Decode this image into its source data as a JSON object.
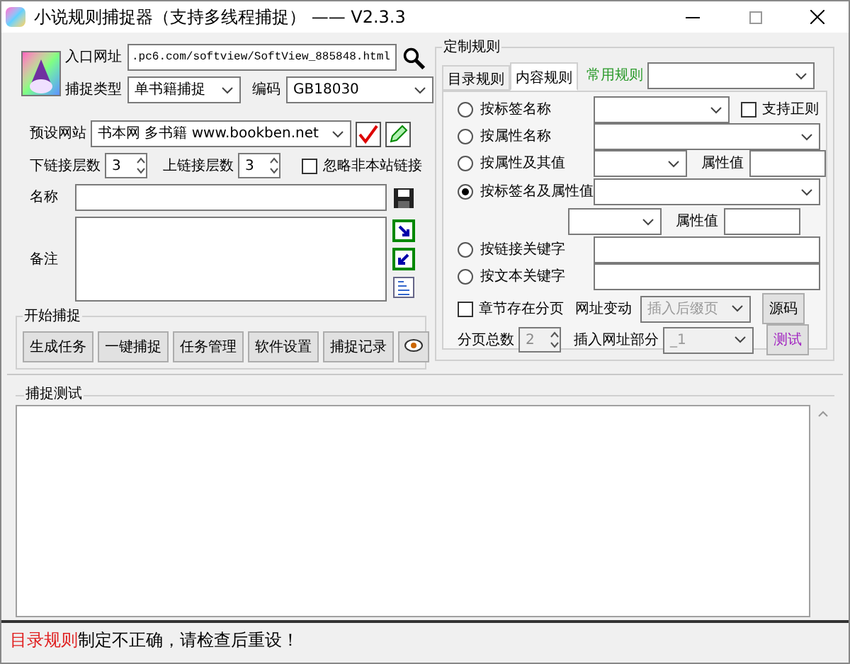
{
  "window": {
    "title": "小说规则捕捉器（支持多线程捕捉） —— V2.3.3"
  },
  "left": {
    "url": {
      "label": "入口网址",
      "value": ".pc6.com/softview/SoftView_885848.html"
    },
    "capture_type": {
      "label": "捕捉类型",
      "value": "单书籍捕捉"
    },
    "encoding": {
      "label": "编码",
      "value": "GB18030"
    },
    "preset": {
      "label": "预设网站",
      "value": "书本网 多书籍 www.bookben.net"
    },
    "down_levels": {
      "label": "下链接层数",
      "value": "3"
    },
    "up_levels": {
      "label": "上链接层数",
      "value": "3"
    },
    "ignore_external": {
      "label": "忽略非本站链接",
      "checked": false
    },
    "name": {
      "label": "名称"
    },
    "notes": {
      "label": "备注"
    },
    "start": {
      "title": "开始捕捉",
      "buttons": [
        "生成任务",
        "一键捕捉",
        "任务管理",
        "软件设置",
        "捕捉记录"
      ]
    }
  },
  "rules": {
    "title": "定制规则",
    "tabs": [
      {
        "label": "目录规则",
        "selected": false
      },
      {
        "label": "内容规则",
        "selected": true
      }
    ],
    "common_label": "常用规则",
    "options": [
      {
        "kind": "select_check",
        "label": "按标签名称",
        "selected": false,
        "check_label": "支持正则",
        "checked": false
      },
      {
        "kind": "select",
        "label": "按属性名称",
        "selected": false
      },
      {
        "kind": "select_attr",
        "label": "按属性及其值",
        "selected": false,
        "attr_label": "属性值"
      },
      {
        "kind": "select_then_attr",
        "label": "按标签名及属性值",
        "selected": true,
        "attr_label": "属性值"
      },
      {
        "kind": "input",
        "label": "按链接关键字",
        "selected": false
      },
      {
        "kind": "input",
        "label": "按文本关键字",
        "selected": false
      }
    ],
    "paging": {
      "label": "章节存在分页",
      "checked": false
    },
    "url_change": {
      "label": "网址变动",
      "value": "插入后缀页",
      "disabled": true
    },
    "source_button": "源码",
    "page_total": {
      "label": "分页总数",
      "value": "2",
      "disabled": true
    },
    "insert_part": {
      "label": "插入网址部分",
      "value": "_1",
      "disabled": true
    },
    "test_button": "测试"
  },
  "test": {
    "title": "捕捉测试"
  },
  "status": [
    {
      "kind": "highlight",
      "text": "目录规则"
    },
    {
      "kind": "plain",
      "text": "制定不正确，请检查后重设！"
    }
  ]
}
